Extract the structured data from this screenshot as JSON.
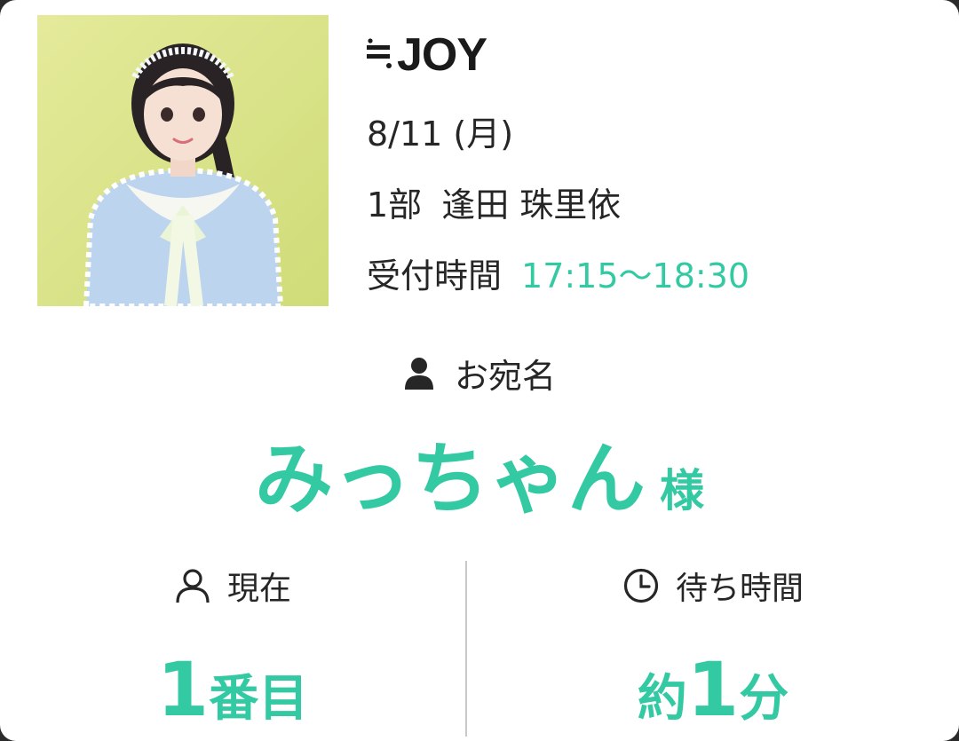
{
  "header": {
    "group_name": "JOY",
    "logo_icon": "near-equal-icon"
  },
  "event": {
    "date": "8/11 (月)",
    "part": "1部",
    "member": "逢田 珠里依",
    "reception_label": "受付時間",
    "reception_time": "17:15〜18:30"
  },
  "recipient": {
    "label": "お宛名",
    "label_icon": "person-icon",
    "name": "みっちゃん",
    "honorific": "様"
  },
  "status": {
    "current_label": "現在",
    "current_icon": "user-outline-icon",
    "current_prefix": "1",
    "current_suffix": "番目",
    "wait_label": "待ち時間",
    "wait_icon": "clock-icon",
    "wait_prefix": "約",
    "wait_number": "1",
    "wait_unit": "分"
  },
  "colors": {
    "accent": "#33c9a3",
    "text": "#262626",
    "divider": "#c8c8c8"
  }
}
